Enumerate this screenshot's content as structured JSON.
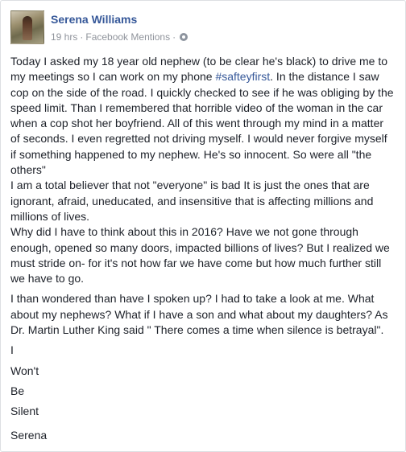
{
  "post": {
    "author": "Serena Williams",
    "time": "19 hrs",
    "separator": "·",
    "source": "Facebook Mentions",
    "paragraph1_before": "Today I asked my 18 year old nephew (to be clear he's black) to drive me to my meetings so I can work on my phone ",
    "hashtag": "#safteyfirst",
    "paragraph1_after": ". In the distance I saw cop on the side of the road. I quickly checked to see if he was obliging by the speed limit. Than I remembered that horrible video of the woman in the car when a cop shot her boyfriend. All of this went through my mind in a matter of seconds. I even regretted not driving myself. I would never forgive myself if something happened to my nephew. He's so innocent. So were all \"the others\"",
    "paragraph2": "I am a total believer that not \"everyone\" is bad It is just the ones that are ignorant, afraid, uneducated, and insensitive that is affecting millions and millions of lives.",
    "paragraph3": "Why did I have to think about this in 2016? Have we not gone through enough, opened so many doors, impacted billions of lives? But I realized we must stride on- for it's not how far we have come but how much further still we have to go.",
    "paragraph4": "I than wondered than have I spoken up? I had to take a look at me. What about my nephews? What if I have a son and what about my daughters? As Dr. Martin Luther King said \" There comes a time when silence is betrayal\".",
    "closing": [
      "I",
      "Won't",
      "Be",
      "Silent"
    ],
    "signature": "Serena"
  },
  "icons": {
    "privacy": "globe-icon",
    "options": "chevron-down-icon"
  }
}
